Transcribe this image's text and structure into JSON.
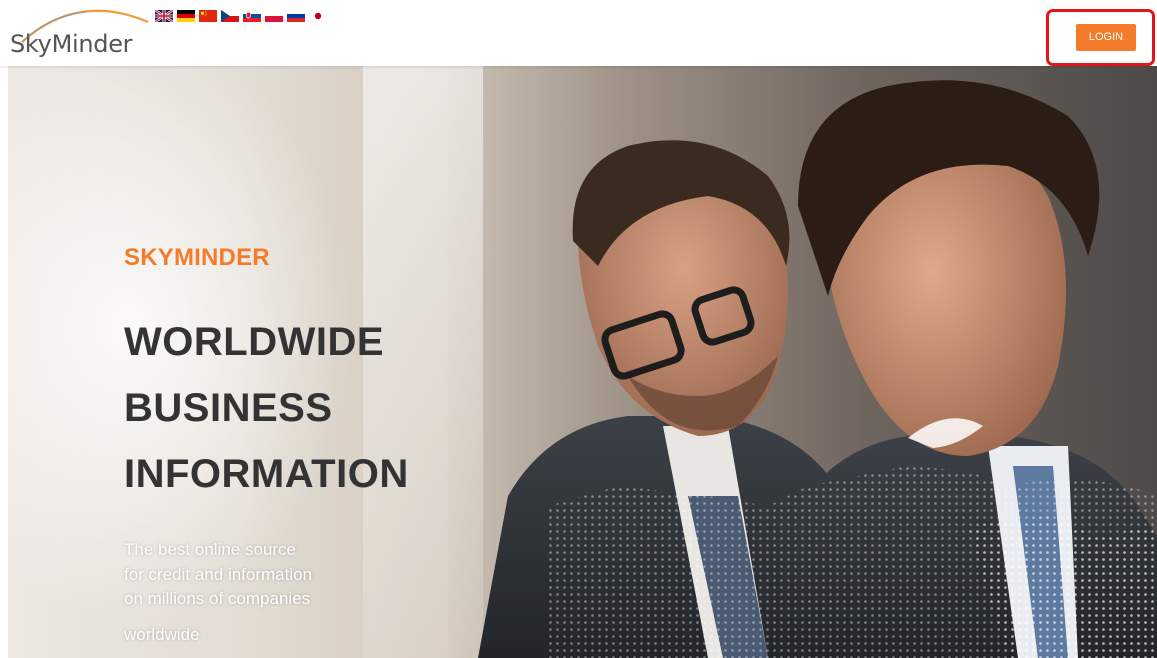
{
  "header": {
    "logo_text": "SkyMinder",
    "login_label": "LOGIN"
  },
  "language_flags": [
    {
      "icon": "uk-flag-icon"
    },
    {
      "icon": "germany-flag-icon"
    },
    {
      "icon": "china-flag-icon"
    },
    {
      "icon": "czech-flag-icon"
    },
    {
      "icon": "slovakia-flag-icon"
    },
    {
      "icon": "poland-flag-icon"
    },
    {
      "icon": "russia-flag-icon"
    },
    {
      "icon": "japan-flag-icon"
    }
  ],
  "hero": {
    "brand": "SKYMINDER",
    "headline": [
      "WORLDWIDE",
      "BUSINESS",
      "INFORMATION"
    ],
    "tagline": [
      "The best online source",
      "for credit and information",
      "on millions of companies",
      "worldwide"
    ]
  },
  "colors": {
    "accent": "#f47b2a",
    "headline": "#333333",
    "highlight": "#e2151b"
  }
}
